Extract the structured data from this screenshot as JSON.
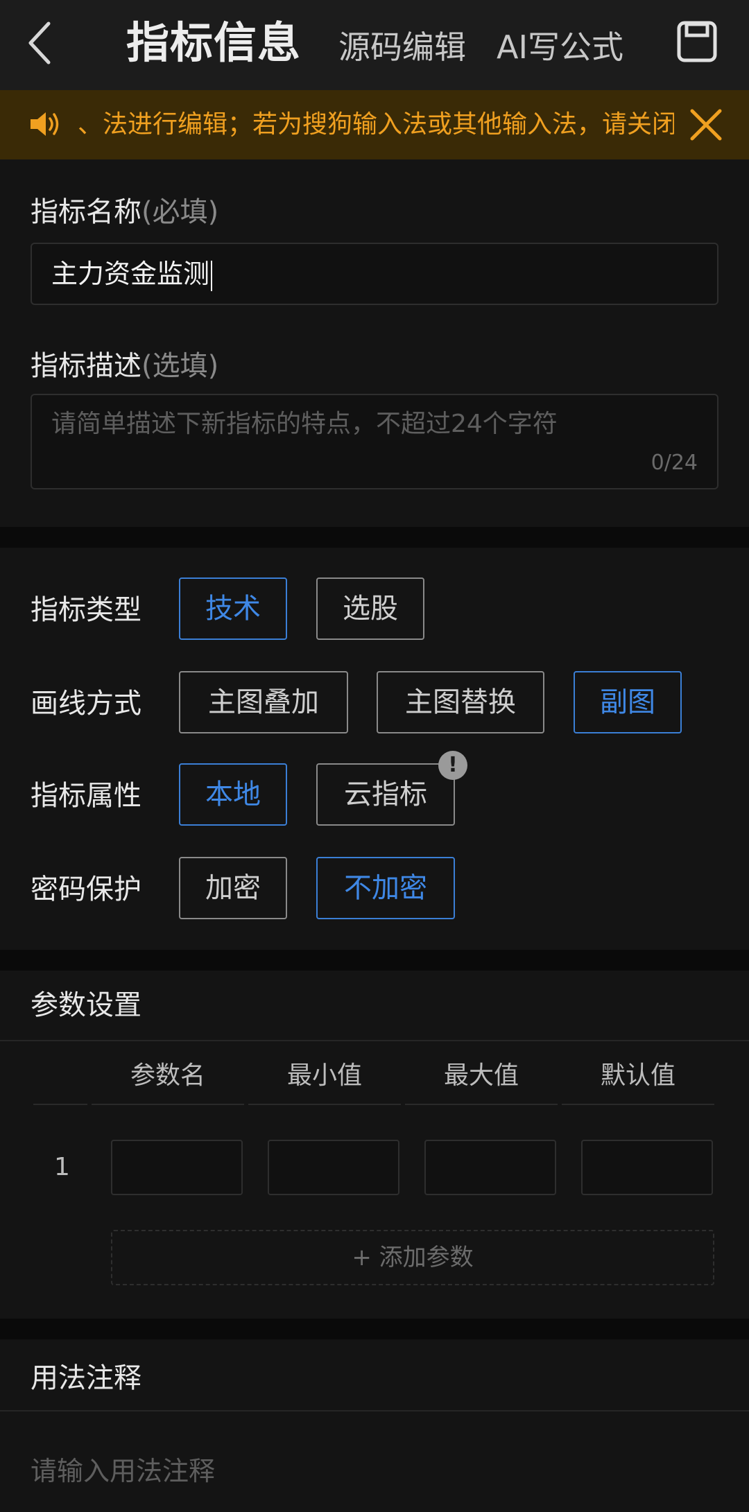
{
  "header": {
    "title": "指标信息",
    "tab_source": "源码编辑",
    "tab_ai": "AI写公式"
  },
  "notice": {
    "text": "、法进行编辑；若为搜狗输入法或其他输入法，请关闭英文"
  },
  "basic": {
    "name_label": "指标名称",
    "name_required": "(必填)",
    "name_value": "主力资金监测",
    "desc_label": "指标描述",
    "desc_optional": "(选填)",
    "desc_placeholder": "请简单描述下新指标的特点，不超过24个字符",
    "desc_count": "0/24"
  },
  "options": {
    "type_label": "指标类型",
    "type_choices": [
      "技术",
      "选股"
    ],
    "draw_label": "画线方式",
    "draw_choices": [
      "主图叠加",
      "主图替换",
      "副图"
    ],
    "attr_label": "指标属性",
    "attr_choices": [
      "本地",
      "云指标"
    ],
    "pwd_label": "密码保护",
    "pwd_choices": [
      "加密",
      "不加密"
    ],
    "warn_glyph": "!",
    "accent_color": "#3f88e6"
  },
  "params": {
    "title": "参数设置",
    "columns": [
      "参数名",
      "最小值",
      "最大值",
      "默认值"
    ],
    "row_index": "1",
    "add_label": "+ 添加参数"
  },
  "usage": {
    "title": "用法注释",
    "placeholder": "请输入用法注释"
  }
}
